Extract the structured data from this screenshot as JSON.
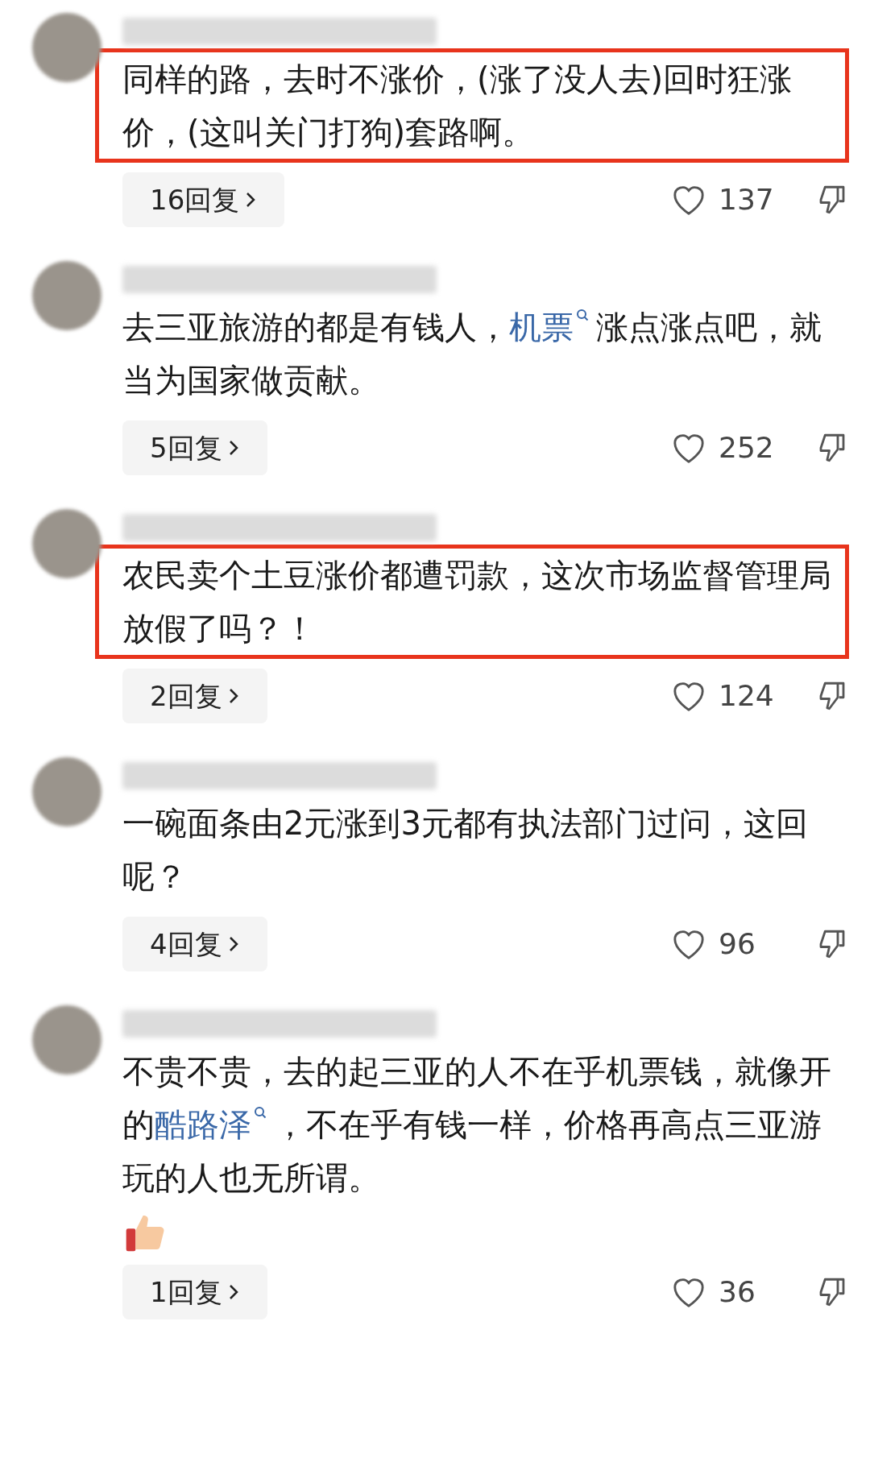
{
  "comments": [
    {
      "highlighted": true,
      "segments": [
        {
          "kind": "text",
          "text": "同样的路，去时不涨价，(涨了没人去)回时狂涨价，(这叫关门打狗)套路啊。"
        }
      ],
      "replies": "16回复",
      "likes": "137"
    },
    {
      "highlighted": false,
      "segments": [
        {
          "kind": "text",
          "text": "去三亚旅游的都是有钱人，"
        },
        {
          "kind": "link",
          "text": "机票"
        },
        {
          "kind": "text",
          "text": "涨点涨点吧，就当为国家做贡献。"
        }
      ],
      "replies": "5回复",
      "likes": "252"
    },
    {
      "highlighted": true,
      "segments": [
        {
          "kind": "text",
          "text": "农民卖个土豆涨价都遭罚款，这次市场监督管理局放假了吗？！"
        }
      ],
      "replies": "2回复",
      "likes": "124"
    },
    {
      "highlighted": false,
      "segments": [
        {
          "kind": "text",
          "text": "一碗面条由2元涨到3元都有执法部门过问，这回呢？"
        }
      ],
      "replies": "4回复",
      "likes": "96"
    },
    {
      "highlighted": false,
      "segments": [
        {
          "kind": "text",
          "text": "不贵不贵，去的起三亚的人不在乎机票钱，就像开的"
        },
        {
          "kind": "link",
          "text": "酷路泽"
        },
        {
          "kind": "text",
          "text": "，不在乎有钱一样，价格再高点三亚游玩的人也无所谓。"
        }
      ],
      "reactions": [
        {
          "kind": "thumbs_up"
        }
      ],
      "replies": "1回复",
      "likes": "36"
    }
  ]
}
